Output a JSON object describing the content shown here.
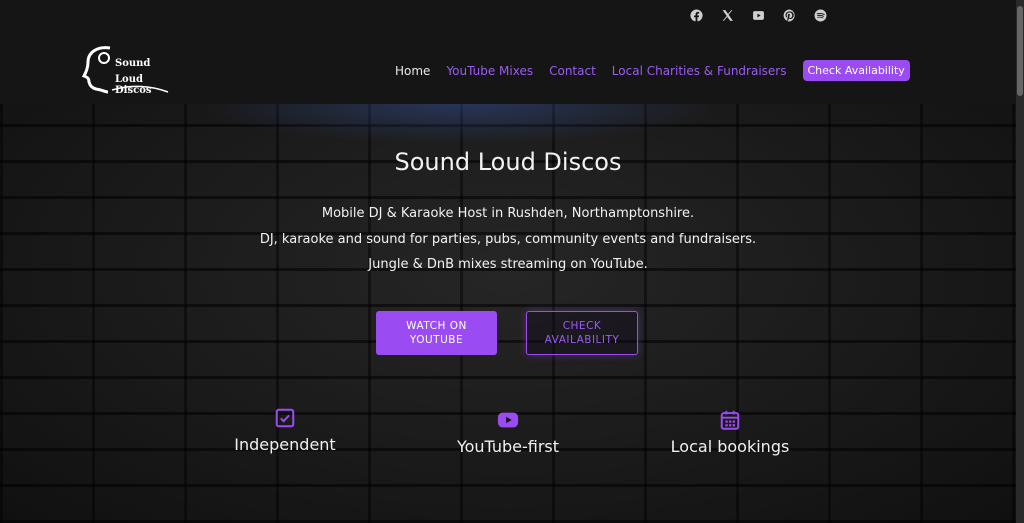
{
  "header": {
    "socials": [
      "facebook-icon",
      "x-icon",
      "youtube-icon",
      "pinterest-icon",
      "spotify-icon"
    ],
    "logo": {
      "line1": "Sound",
      "line2": "Loud Discos"
    },
    "nav": [
      {
        "label": "Home"
      },
      {
        "label": "YouTube Mixes"
      },
      {
        "label": "Contact"
      },
      {
        "label": "Local Charities & Fundraisers"
      }
    ],
    "cta_label": "Check Availability"
  },
  "hero": {
    "title": "Sound Loud Discos",
    "lines": [
      "Mobile DJ & Karaoke Host in Rushden, Northamptonshire.",
      "DJ, karaoke and sound for parties, pubs, community events and fundraisers.",
      "Jungle & DnB mixes streaming on YouTube."
    ],
    "buttons": {
      "youtube": "WATCH ON YOUTUBE",
      "availability": "CHECK AVAILABILITY"
    }
  },
  "features": [
    {
      "icon": "checkbox-icon",
      "label": "Independent"
    },
    {
      "icon": "youtube-play-icon",
      "label": "YouTube-first"
    },
    {
      "icon": "calendar-icon",
      "label": "Local bookings"
    }
  ],
  "colors": {
    "accent": "#9a4cf2",
    "header_bg": "#151515",
    "text": "#f2f2f2"
  }
}
